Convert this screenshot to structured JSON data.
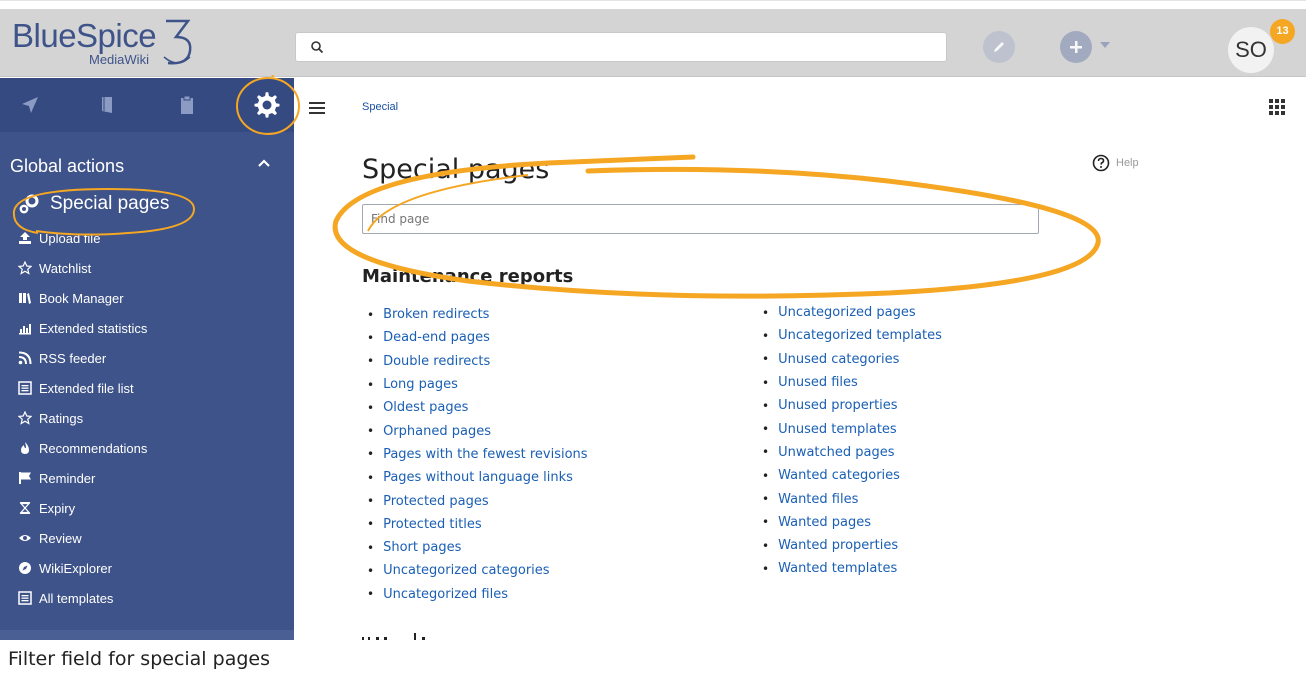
{
  "header": {
    "logo_main": "BlueSpice",
    "logo_sub": "MediaWiki",
    "logo_number": "3",
    "search_value": "",
    "avatar_initials": "SO",
    "notification_count": "13"
  },
  "sidebar": {
    "section_title": "Global actions",
    "items": [
      {
        "label": "Special pages",
        "icon": "gears-icon",
        "active": true
      },
      {
        "label": "Upload file",
        "icon": "upload-icon"
      },
      {
        "label": "Watchlist",
        "icon": "star-outline-icon"
      },
      {
        "label": "Book Manager",
        "icon": "book-icon"
      },
      {
        "label": "Extended statistics",
        "icon": "chart-icon"
      },
      {
        "label": "RSS feeder",
        "icon": "rss-icon"
      },
      {
        "label": "Extended file list",
        "icon": "list-icon"
      },
      {
        "label": "Ratings",
        "icon": "star-outline-icon"
      },
      {
        "label": "Recommendations",
        "icon": "fire-icon"
      },
      {
        "label": "Reminder",
        "icon": "flag-icon"
      },
      {
        "label": "Expiry",
        "icon": "hourglass-icon"
      },
      {
        "label": "Review",
        "icon": "eye-icon"
      },
      {
        "label": "WikiExplorer",
        "icon": "compass-icon"
      },
      {
        "label": "All templates",
        "icon": "list-icon"
      }
    ]
  },
  "main": {
    "breadcrumb": "Special",
    "title": "Special pages",
    "help_label": "Help",
    "find_placeholder": "Find page",
    "section_title": "Maintenance reports",
    "col1": [
      "Broken redirects",
      "Dead-end pages",
      "Double redirects",
      "Long pages",
      "Oldest pages",
      "Orphaned pages",
      "Pages with the fewest revisions",
      "Pages without language links",
      "Protected pages",
      "Protected titles",
      "Short pages",
      "Uncategorized categories",
      "Uncategorized files"
    ],
    "col2": [
      "Uncategorized pages",
      "Uncategorized templates",
      "Unused categories",
      "Unused files",
      "Unused properties",
      "Unused templates",
      "Unwatched pages",
      "Wanted categories",
      "Wanted files",
      "Wanted pages",
      "Wanted properties",
      "Wanted templates"
    ]
  },
  "caption": "Filter field for special pages",
  "colors": {
    "sidebar": "#3e5389",
    "link": "#1a5fb4",
    "annotation": "#f5a623"
  }
}
